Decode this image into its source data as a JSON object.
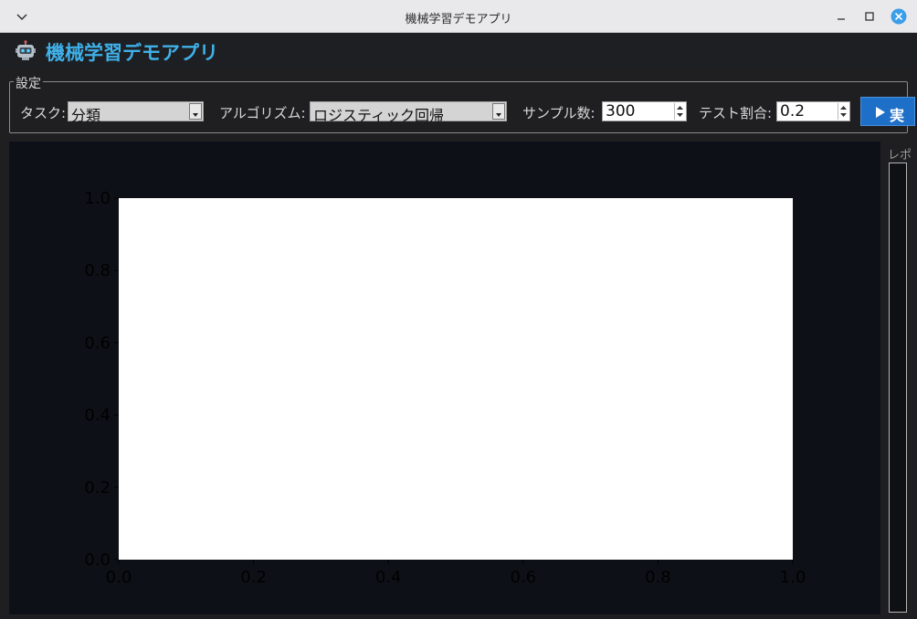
{
  "window": {
    "title": "機械学習デモアプリ"
  },
  "header": {
    "icon": "robot-icon",
    "title": "機械学習デモアプリ"
  },
  "settings": {
    "legend": "設定",
    "task_label": "タスク:",
    "task_value": "分類",
    "algorithm_label": "アルゴリズム:",
    "algorithm_value": "ロジスティック回帰",
    "samples_label": "サンプル数:",
    "samples_value": "300",
    "test_ratio_label": "テスト割合:",
    "test_ratio_value": "0.2",
    "run_label": "実"
  },
  "log": {
    "label": "レポ"
  },
  "chart_data": {
    "type": "scatter",
    "title": "",
    "xlabel": "",
    "ylabel": "",
    "xlim": [
      0,
      1
    ],
    "ylim": [
      0,
      1
    ],
    "x_ticks": [
      "0.0",
      "0.2",
      "0.4",
      "0.6",
      "0.8",
      "1.0"
    ],
    "y_ticks": [
      "0.0",
      "0.2",
      "0.4",
      "0.6",
      "0.8",
      "1.0"
    ],
    "series": [],
    "grid": false,
    "background": "#ffffff",
    "figure_background": "#0d1117"
  },
  "colors": {
    "accent": "#3fb0e8",
    "run_button": "#1e6fc8"
  }
}
